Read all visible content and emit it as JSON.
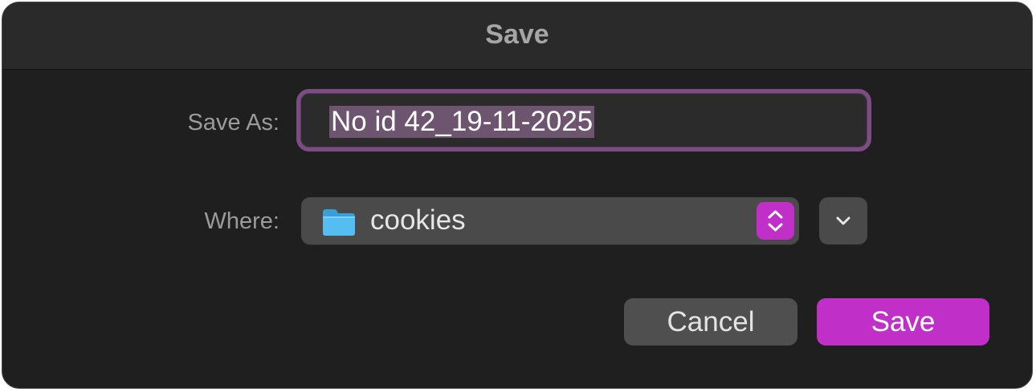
{
  "dialog": {
    "title": "Save"
  },
  "save_as": {
    "label": "Save As:",
    "value": "No id 42_19-11-2025"
  },
  "where": {
    "label": "Where:",
    "selected": "cookies",
    "icon": "folder-icon"
  },
  "buttons": {
    "cancel": "Cancel",
    "save": "Save"
  },
  "colors": {
    "accent": "#c02fc8",
    "focus_ring": "#7b4d80",
    "folder_blue": "#4bb3ec",
    "background": "#1f1f1f"
  }
}
